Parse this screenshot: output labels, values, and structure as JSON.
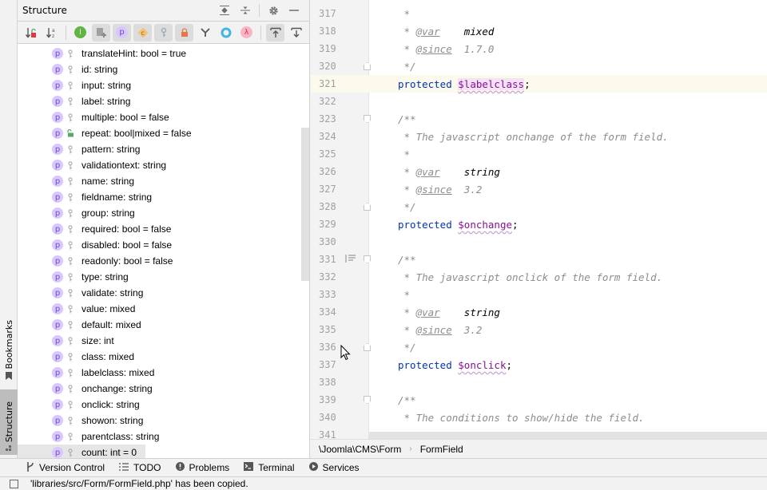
{
  "left_stripe": {
    "bookmarks_label": "Bookmarks",
    "structure_label": "Structure"
  },
  "structure_panel": {
    "title": "Structure",
    "header_icons": [
      "expand-all-icon",
      "collapse-all-icon",
      "gear-icon",
      "minimize-icon"
    ],
    "toolbar_icons": [
      "sort-by-visibility-icon",
      "sort-alphabetically-icon",
      "show-inherited-icon",
      "show-includes-icon",
      "show-properties-icon",
      "show-constants-icon",
      "show-fields-icon",
      "show-non-public-icon",
      "show-traits-icon",
      "show-interfaces-icon",
      "show-lambdas-icon",
      "autoscroll-to-source-icon",
      "autoscroll-from-source-icon"
    ],
    "items": [
      {
        "label": "translateHint: bool = true",
        "visibility": "private"
      },
      {
        "label": "id: string",
        "visibility": "private"
      },
      {
        "label": "input: string",
        "visibility": "private"
      },
      {
        "label": "label: string",
        "visibility": "private"
      },
      {
        "label": "multiple: bool = false",
        "visibility": "private"
      },
      {
        "label": "repeat: bool|mixed = false",
        "visibility": "public"
      },
      {
        "label": "pattern: string",
        "visibility": "private"
      },
      {
        "label": "validationtext: string",
        "visibility": "private"
      },
      {
        "label": "name: string",
        "visibility": "private"
      },
      {
        "label": "fieldname: string",
        "visibility": "private"
      },
      {
        "label": "group: string",
        "visibility": "private"
      },
      {
        "label": "required: bool = false",
        "visibility": "private"
      },
      {
        "label": "disabled: bool = false",
        "visibility": "private"
      },
      {
        "label": "readonly: bool = false",
        "visibility": "private"
      },
      {
        "label": "type: string",
        "visibility": "private"
      },
      {
        "label": "validate: string",
        "visibility": "private"
      },
      {
        "label": "value: mixed",
        "visibility": "private"
      },
      {
        "label": "default: mixed",
        "visibility": "private"
      },
      {
        "label": "size: int",
        "visibility": "private"
      },
      {
        "label": "class: mixed",
        "visibility": "private"
      },
      {
        "label": "labelclass: mixed",
        "visibility": "private"
      },
      {
        "label": "onchange: string",
        "visibility": "private"
      },
      {
        "label": "onclick: string",
        "visibility": "private"
      },
      {
        "label": "showon: string",
        "visibility": "private"
      },
      {
        "label": "parentclass: string",
        "visibility": "private"
      },
      {
        "label": "count: int = 0",
        "visibility": "private"
      }
    ],
    "badge_letter": "p"
  },
  "editor": {
    "current_line": 321,
    "lines": [
      {
        "n": "317",
        "tokens": [
          {
            "t": " *",
            "c": "cm"
          }
        ]
      },
      {
        "n": "318",
        "tokens": [
          {
            "t": " * ",
            "c": "cm"
          },
          {
            "t": "@var",
            "c": "tag"
          },
          {
            "t": "    ",
            "c": "cm"
          },
          {
            "t": "mixed",
            "c": "tval"
          }
        ]
      },
      {
        "n": "319",
        "tokens": [
          {
            "t": " * ",
            "c": "cm"
          },
          {
            "t": "@since",
            "c": "tag"
          },
          {
            "t": "  1.7.0",
            "c": "cm"
          }
        ]
      },
      {
        "n": "320",
        "tokens": [
          {
            "t": " */",
            "c": "cm"
          }
        ],
        "fold": "close"
      },
      {
        "n": "321",
        "tokens": [
          {
            "t": "protected ",
            "c": "kw"
          },
          {
            "t": "$labelclass",
            "c": "var hl"
          },
          {
            "t": ";",
            "c": ""
          }
        ]
      },
      {
        "n": "322",
        "tokens": []
      },
      {
        "n": "323",
        "tokens": [
          {
            "t": "/**",
            "c": "cm"
          }
        ],
        "fold": "open"
      },
      {
        "n": "324",
        "tokens": [
          {
            "t": " * The javascript onchange of the form field.",
            "c": "cm"
          }
        ]
      },
      {
        "n": "325",
        "tokens": [
          {
            "t": " *",
            "c": "cm"
          }
        ]
      },
      {
        "n": "326",
        "tokens": [
          {
            "t": " * ",
            "c": "cm"
          },
          {
            "t": "@var",
            "c": "tag"
          },
          {
            "t": "    ",
            "c": "cm"
          },
          {
            "t": "string",
            "c": "tval"
          }
        ]
      },
      {
        "n": "327",
        "tokens": [
          {
            "t": " * ",
            "c": "cm"
          },
          {
            "t": "@since",
            "c": "tag"
          },
          {
            "t": "  3.2",
            "c": "cm"
          }
        ]
      },
      {
        "n": "328",
        "tokens": [
          {
            "t": " */",
            "c": "cm"
          }
        ],
        "fold": "close"
      },
      {
        "n": "329",
        "tokens": [
          {
            "t": "protected ",
            "c": "kw"
          },
          {
            "t": "$onchange",
            "c": "var"
          },
          {
            "t": ";",
            "c": ""
          }
        ]
      },
      {
        "n": "330",
        "tokens": []
      },
      {
        "n": "331",
        "tokens": [
          {
            "t": "/**",
            "c": "cm"
          }
        ],
        "fold": "open",
        "doc_icon": true
      },
      {
        "n": "332",
        "tokens": [
          {
            "t": " * The javascript onclick of the form field.",
            "c": "cm"
          }
        ]
      },
      {
        "n": "333",
        "tokens": [
          {
            "t": " *",
            "c": "cm"
          }
        ]
      },
      {
        "n": "334",
        "tokens": [
          {
            "t": " * ",
            "c": "cm"
          },
          {
            "t": "@var",
            "c": "tag"
          },
          {
            "t": "    ",
            "c": "cm"
          },
          {
            "t": "string",
            "c": "tval"
          }
        ]
      },
      {
        "n": "335",
        "tokens": [
          {
            "t": " * ",
            "c": "cm"
          },
          {
            "t": "@since",
            "c": "tag"
          },
          {
            "t": "  3.2",
            "c": "cm"
          }
        ]
      },
      {
        "n": "336",
        "tokens": [
          {
            "t": " */",
            "c": "cm"
          }
        ],
        "fold": "close"
      },
      {
        "n": "337",
        "tokens": [
          {
            "t": "protected ",
            "c": "kw"
          },
          {
            "t": "$onclick",
            "c": "var"
          },
          {
            "t": ";",
            "c": ""
          }
        ]
      },
      {
        "n": "338",
        "tokens": []
      },
      {
        "n": "339",
        "tokens": [
          {
            "t": "/**",
            "c": "cm"
          }
        ],
        "fold": "open"
      },
      {
        "n": "340",
        "tokens": [
          {
            "t": " * The conditions to show/hide the field.",
            "c": "cm"
          }
        ]
      },
      {
        "n": "341",
        "tokens": [
          {
            "t": " *",
            "c": "cm"
          }
        ]
      }
    ]
  },
  "breadcrumb": {
    "items": [
      "\\Joomla\\CMS\\Form",
      "FormField"
    ]
  },
  "tool_windows": [
    {
      "label": "Version Control",
      "icon": "version-control-icon"
    },
    {
      "label": "TODO",
      "icon": "todo-icon"
    },
    {
      "label": "Problems",
      "icon": "problems-icon"
    },
    {
      "label": "Terminal",
      "icon": "terminal-icon"
    },
    {
      "label": "Services",
      "icon": "services-icon"
    }
  ],
  "status": {
    "message": "'libraries/src/Form/FormField.php' has been copied."
  }
}
